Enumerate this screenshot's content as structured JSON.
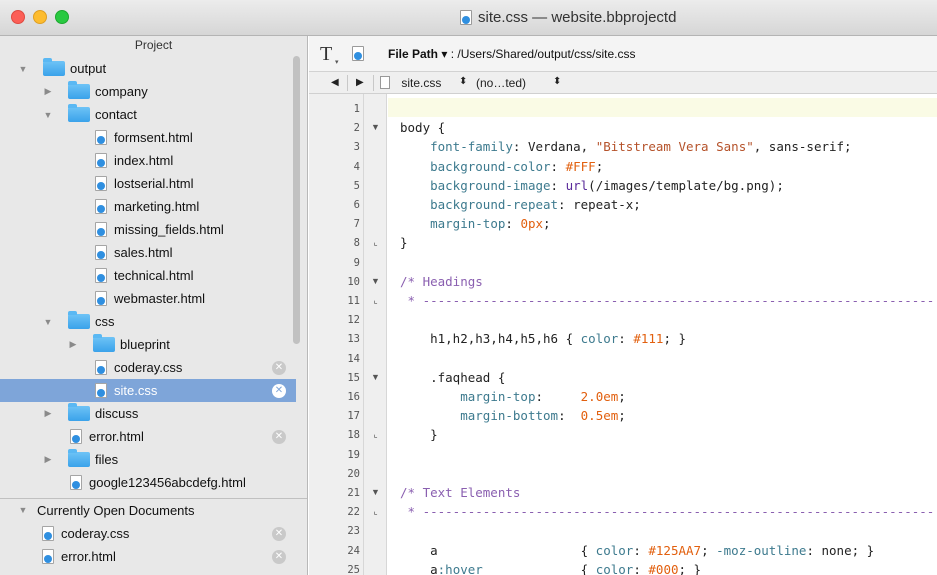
{
  "window": {
    "title": "site.css — website.bbprojectd"
  },
  "sidebar": {
    "header": "Project",
    "tree": [
      {
        "label": "output",
        "kind": "folder",
        "depth": 0,
        "expanded": true
      },
      {
        "label": "company",
        "kind": "folder",
        "depth": 1,
        "expanded": false
      },
      {
        "label": "contact",
        "kind": "folder",
        "depth": 1,
        "expanded": true
      },
      {
        "label": "formsent.html",
        "kind": "file",
        "depth": 2
      },
      {
        "label": "index.html",
        "kind": "file",
        "depth": 2
      },
      {
        "label": "lostserial.html",
        "kind": "file",
        "depth": 2
      },
      {
        "label": "marketing.html",
        "kind": "file",
        "depth": 2
      },
      {
        "label": "missing_fields.html",
        "kind": "file",
        "depth": 2
      },
      {
        "label": "sales.html",
        "kind": "file",
        "depth": 2
      },
      {
        "label": "technical.html",
        "kind": "file",
        "depth": 2
      },
      {
        "label": "webmaster.html",
        "kind": "file",
        "depth": 2
      },
      {
        "label": "css",
        "kind": "folder",
        "depth": 1,
        "expanded": true
      },
      {
        "label": "blueprint",
        "kind": "folder",
        "depth": 2,
        "expanded": false
      },
      {
        "label": "coderay.css",
        "kind": "file",
        "depth": 2,
        "closable": true
      },
      {
        "label": "site.css",
        "kind": "file",
        "depth": 2,
        "closable": true,
        "selected": true
      },
      {
        "label": "discuss",
        "kind": "folder",
        "depth": 1,
        "expanded": false
      },
      {
        "label": "error.html",
        "kind": "file",
        "depth": 1,
        "closable": true
      },
      {
        "label": "files",
        "kind": "folder",
        "depth": 1,
        "expanded": false
      },
      {
        "label": "google123456abcdefg.html",
        "kind": "file",
        "depth": 1
      }
    ],
    "open_docs": {
      "header": "Currently Open Documents",
      "items": [
        "coderay.css",
        "error.html"
      ]
    }
  },
  "toolbar": {
    "text_tool": "T",
    "file_path_label": "File Path",
    "file_path_arrow": "▾",
    "file_path_value": ": /Users/Shared/output/css/site.css"
  },
  "navbar": {
    "back": "◀",
    "forward": "▶",
    "file_name": "site.css",
    "updown": "⬍",
    "symbol": "(no…ted)"
  },
  "editor": {
    "line_numbers": [
      "1",
      "2",
      "3",
      "4",
      "5",
      "6",
      "7",
      "8",
      "9",
      "10",
      "11",
      "12",
      "13",
      "14",
      "15",
      "16",
      "17",
      "18",
      "19",
      "20",
      "21",
      "22",
      "23",
      "24",
      "25"
    ],
    "folds": {
      "2": "▼",
      "8": "⌞",
      "10": "▼",
      "11": "⌞",
      "15": "▼",
      "18": "⌞",
      "21": "▼",
      "22": "⌞"
    },
    "lines": [
      [],
      [
        [
          "",
          "body {"
        ]
      ],
      [
        [
          "",
          "    "
        ],
        [
          "k-prop",
          "font-family"
        ],
        [
          "",
          ": Verdana, "
        ],
        [
          "k-str",
          "\"Bitstream Vera Sans\""
        ],
        [
          "",
          ", sans-serif;"
        ]
      ],
      [
        [
          "",
          "    "
        ],
        [
          "k-prop",
          "background-color"
        ],
        [
          "",
          ": "
        ],
        [
          "k-num",
          "#FFF"
        ],
        [
          "",
          ";"
        ]
      ],
      [
        [
          "",
          "    "
        ],
        [
          "k-prop",
          "background-image"
        ],
        [
          "",
          ": "
        ],
        [
          "k-func",
          "url"
        ],
        [
          "",
          "(/images/template/bg.png);"
        ]
      ],
      [
        [
          "",
          "    "
        ],
        [
          "k-prop",
          "background-repeat"
        ],
        [
          "",
          ": repeat-x;"
        ]
      ],
      [
        [
          "",
          "    "
        ],
        [
          "k-prop",
          "margin-top"
        ],
        [
          "",
          ": "
        ],
        [
          "k-num",
          "0px"
        ],
        [
          "",
          ";"
        ]
      ],
      [
        [
          "",
          "}"
        ]
      ],
      [],
      [
        [
          "k-comment",
          "/* Headings"
        ]
      ],
      [
        [
          "k-comment",
          " * --------------------------------------------------------------------"
        ]
      ],
      [],
      [
        [
          "",
          "    h1,h2,h3,h4,h5,h6 { "
        ],
        [
          "k-prop",
          "color"
        ],
        [
          "",
          ": "
        ],
        [
          "k-num",
          "#111"
        ],
        [
          "",
          "; }"
        ]
      ],
      [],
      [
        [
          "",
          "    .faqhead {"
        ]
      ],
      [
        [
          "",
          "        "
        ],
        [
          "k-prop",
          "margin-top"
        ],
        [
          "",
          ":     "
        ],
        [
          "k-num",
          "2.0em"
        ],
        [
          "",
          ";"
        ]
      ],
      [
        [
          "",
          "        "
        ],
        [
          "k-prop",
          "margin-bottom"
        ],
        [
          "",
          ":  "
        ],
        [
          "k-num",
          "0.5em"
        ],
        [
          "",
          ";"
        ]
      ],
      [
        [
          "",
          "    }"
        ]
      ],
      [],
      [],
      [
        [
          "k-comment",
          "/* Text Elements"
        ]
      ],
      [
        [
          "k-comment",
          " * --------------------------------------------------------------------"
        ]
      ],
      [],
      [
        [
          "",
          "    a                   { "
        ],
        [
          "k-prop",
          "color"
        ],
        [
          "",
          ": "
        ],
        [
          "k-num",
          "#125AA7"
        ],
        [
          "",
          "; "
        ],
        [
          "k-prop",
          "-moz-outline"
        ],
        [
          "",
          ": none; }"
        ]
      ],
      [
        [
          "",
          "    a"
        ],
        [
          "k-pseudo",
          ":hover"
        ],
        [
          "",
          "             { "
        ],
        [
          "k-prop",
          "color"
        ],
        [
          "",
          ": "
        ],
        [
          "k-num",
          "#000"
        ],
        [
          "",
          "; }"
        ]
      ]
    ]
  }
}
